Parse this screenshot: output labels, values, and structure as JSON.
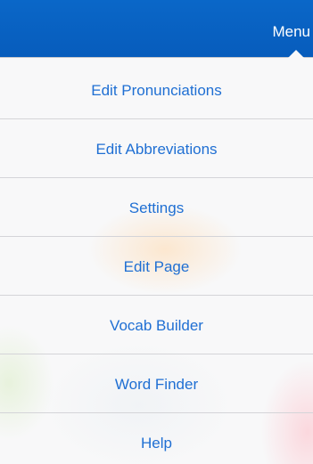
{
  "navigation_bar": {
    "menu_label": "Menu"
  },
  "menu": {
    "items": [
      {
        "label": "Edit Pronunciations"
      },
      {
        "label": "Edit Abbreviations"
      },
      {
        "label": "Settings"
      },
      {
        "label": "Edit Page"
      },
      {
        "label": "Vocab Builder"
      },
      {
        "label": "Word Finder"
      },
      {
        "label": "Help"
      }
    ]
  },
  "colors": {
    "navigation_bar": "#075cbc",
    "menu_text": "#1f6fd3",
    "separator": "#d4d4d8",
    "popover_background": "#f8f8f9"
  }
}
